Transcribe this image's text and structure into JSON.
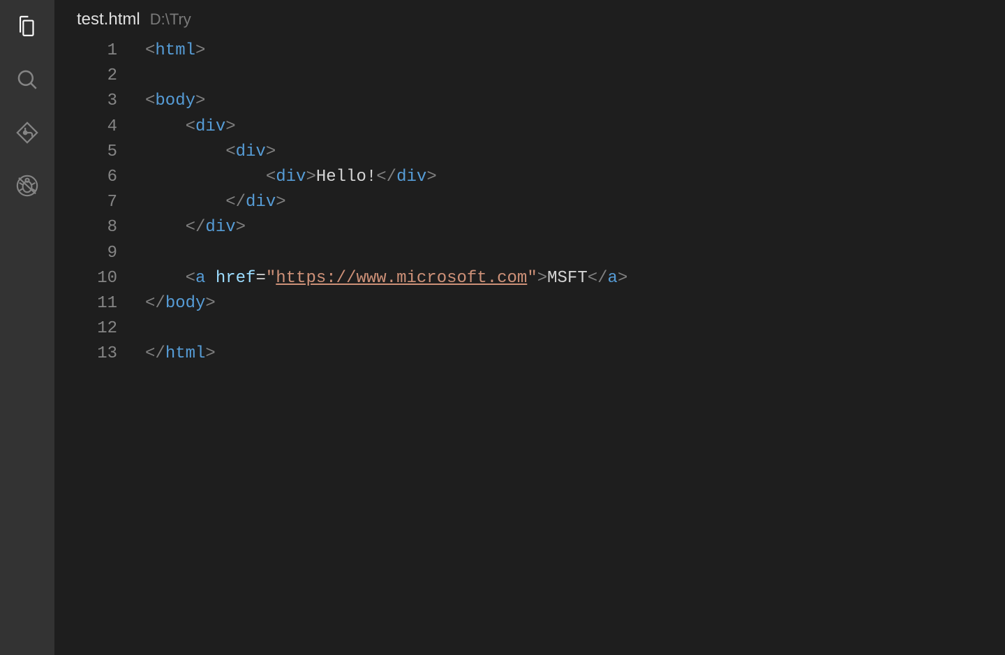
{
  "activityBar": {
    "items": [
      {
        "name": "explorer-icon",
        "active": true
      },
      {
        "name": "search-icon",
        "active": false
      },
      {
        "name": "source-control-icon",
        "active": false
      },
      {
        "name": "debug-icon",
        "active": false
      }
    ]
  },
  "tab": {
    "filename": "test.html",
    "path": "D:\\Try"
  },
  "editor": {
    "lineNumbers": [
      "1",
      "2",
      "3",
      "4",
      "5",
      "6",
      "7",
      "8",
      "9",
      "10",
      "11",
      "12",
      "13"
    ],
    "lines": [
      {
        "indent": 0,
        "tokens": [
          {
            "t": "bracket",
            "v": "<"
          },
          {
            "t": "tag",
            "v": "html"
          },
          {
            "t": "bracket",
            "v": ">"
          }
        ]
      },
      {
        "indent": 0,
        "tokens": []
      },
      {
        "indent": 0,
        "tokens": [
          {
            "t": "bracket",
            "v": "<"
          },
          {
            "t": "tag",
            "v": "body"
          },
          {
            "t": "bracket",
            "v": ">"
          }
        ]
      },
      {
        "indent": 1,
        "tokens": [
          {
            "t": "bracket",
            "v": "<"
          },
          {
            "t": "tag",
            "v": "div"
          },
          {
            "t": "bracket",
            "v": ">"
          }
        ]
      },
      {
        "indent": 2,
        "tokens": [
          {
            "t": "bracket",
            "v": "<"
          },
          {
            "t": "tag",
            "v": "div"
          },
          {
            "t": "bracket",
            "v": ">"
          }
        ]
      },
      {
        "indent": 3,
        "tokens": [
          {
            "t": "bracket",
            "v": "<"
          },
          {
            "t": "tag",
            "v": "div"
          },
          {
            "t": "bracket",
            "v": ">"
          },
          {
            "t": "text",
            "v": "Hello!"
          },
          {
            "t": "bracket",
            "v": "</"
          },
          {
            "t": "tag",
            "v": "div"
          },
          {
            "t": "bracket",
            "v": ">"
          }
        ]
      },
      {
        "indent": 2,
        "tokens": [
          {
            "t": "bracket",
            "v": "</"
          },
          {
            "t": "tag",
            "v": "div"
          },
          {
            "t": "bracket",
            "v": ">"
          }
        ]
      },
      {
        "indent": 1,
        "tokens": [
          {
            "t": "bracket",
            "v": "</"
          },
          {
            "t": "tag",
            "v": "div"
          },
          {
            "t": "bracket",
            "v": ">"
          }
        ]
      },
      {
        "indent": 0,
        "tokens": []
      },
      {
        "indent": 1,
        "tokens": [
          {
            "t": "bracket",
            "v": "<"
          },
          {
            "t": "tag",
            "v": "a"
          },
          {
            "t": "text",
            "v": " "
          },
          {
            "t": "attr",
            "v": "href"
          },
          {
            "t": "punct",
            "v": "="
          },
          {
            "t": "string",
            "v": "\""
          },
          {
            "t": "url",
            "v": "https://www.microsoft.com"
          },
          {
            "t": "string",
            "v": "\""
          },
          {
            "t": "bracket",
            "v": ">"
          },
          {
            "t": "text",
            "v": "MSFT"
          },
          {
            "t": "bracket",
            "v": "</"
          },
          {
            "t": "tag",
            "v": "a"
          },
          {
            "t": "bracket",
            "v": ">"
          }
        ]
      },
      {
        "indent": 0,
        "tokens": [
          {
            "t": "bracket",
            "v": "</"
          },
          {
            "t": "tag",
            "v": "body"
          },
          {
            "t": "bracket",
            "v": ">"
          }
        ]
      },
      {
        "indent": 0,
        "tokens": []
      },
      {
        "indent": 0,
        "tokens": [
          {
            "t": "bracket",
            "v": "</"
          },
          {
            "t": "tag",
            "v": "html"
          },
          {
            "t": "bracket",
            "v": ">"
          }
        ]
      }
    ]
  }
}
